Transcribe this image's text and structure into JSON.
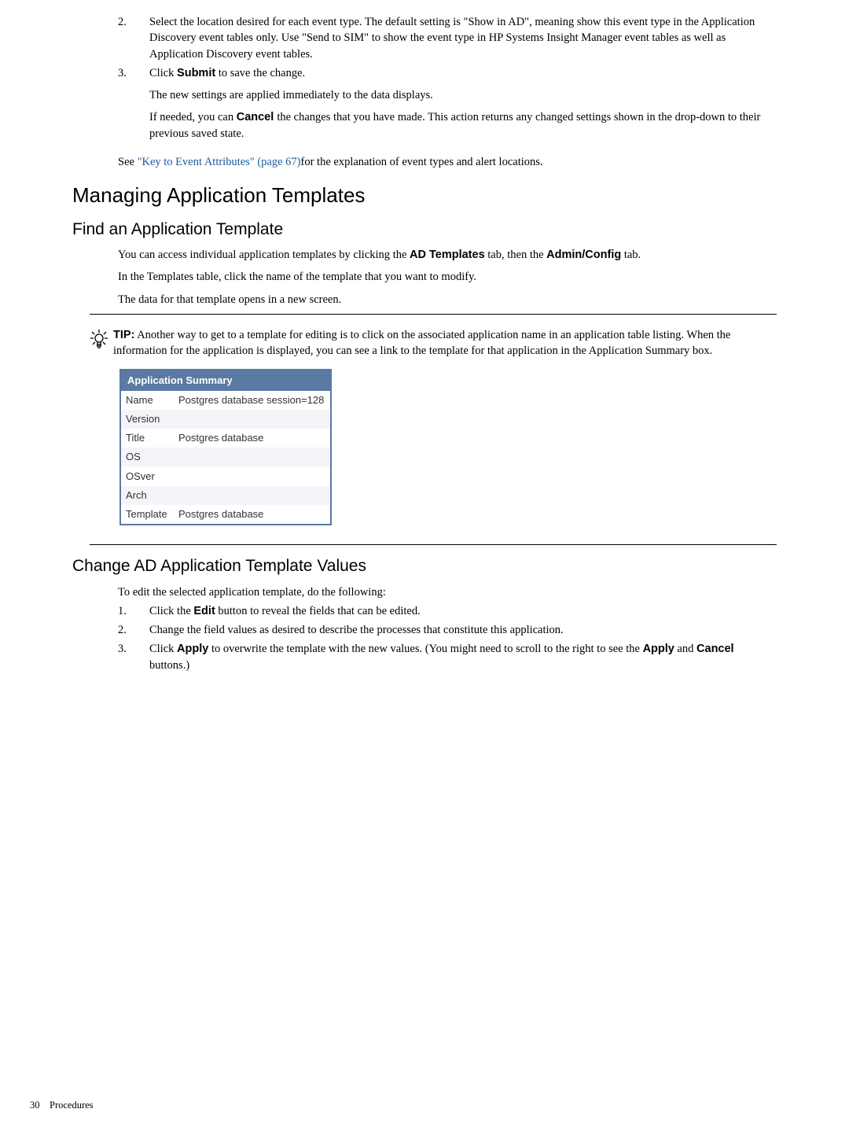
{
  "step2": {
    "num": "2.",
    "text": "Select the location desired for each event type. The default setting is \"Show in AD\", meaning show this event type in the Application Discovery event tables only. Use \"Send to SIM\" to show the event type in HP Systems Insight Manager event tables as well as Application Discovery event tables."
  },
  "step3": {
    "num": "3.",
    "pre": "Click ",
    "bold": "Submit",
    "post": "  to save the change.",
    "sub1": "The new settings are applied immediately to the data displays.",
    "sub2_pre": "If needed, you can ",
    "sub2_bold": " Cancel ",
    "sub2_post": " the changes that you have made. This action returns any changed settings shown in the drop-down to their previous saved state."
  },
  "see_line": {
    "pre": "See ",
    "link": "\"Key to Event Attributes\" (page 67)",
    "post": "for the explanation of event types and alert locations."
  },
  "h1": "Managing Application Templates",
  "h2a": "Find an Application Template",
  "find": {
    "p1_pre": "You can access individual application templates by clicking the ",
    "p1_b1": "AD Templates",
    "p1_mid": " tab, then the ",
    "p1_b2": "Admin/Config",
    "p1_post": " tab.",
    "p2": "In the Templates table, click the name of the template that you want to modify.",
    "p3": "The data for that template opens in a new screen."
  },
  "tip": {
    "label": "TIP:",
    "text": "    Another way to get to a template for editing is to click on the associated application name in an application table listing. When the information for the application is displayed, you can see a link to the template for that application in the Application Summary box."
  },
  "summary": {
    "header": "Application Summary",
    "rows": [
      {
        "label": "Name",
        "value": "Postgres database session=128",
        "shade": false,
        "link": false
      },
      {
        "label": "Version",
        "value": "",
        "shade": true,
        "link": false
      },
      {
        "label": "Title",
        "value": "Postgres database",
        "shade": false,
        "link": false
      },
      {
        "label": "OS",
        "value": "",
        "shade": true,
        "link": false
      },
      {
        "label": "OSver",
        "value": "",
        "shade": false,
        "link": false
      },
      {
        "label": "Arch",
        "value": "",
        "shade": true,
        "link": false
      },
      {
        "label": "Template",
        "value": "Postgres database",
        "shade": false,
        "link": true
      }
    ]
  },
  "h2b": "Change AD Application Template Values",
  "change": {
    "intro": "To edit the selected application template, do the following:",
    "s1": {
      "num": "1.",
      "pre": "Click the ",
      "b": "Edit",
      "post": " button to reveal the fields that can be edited."
    },
    "s2": {
      "num": "2.",
      "text": "Change the field values as desired to describe the processes that constitute this application."
    },
    "s3": {
      "num": "3.",
      "pre": "Click ",
      "b1": "Apply",
      "mid": "  to overwrite the template with the new values. (You might need to scroll to the right to see the ",
      "b2": "Apply",
      "mid2": " and ",
      "b3": "Cancel",
      "post": " buttons.)"
    }
  },
  "footer": {
    "page": "30",
    "label": "Procedures"
  }
}
